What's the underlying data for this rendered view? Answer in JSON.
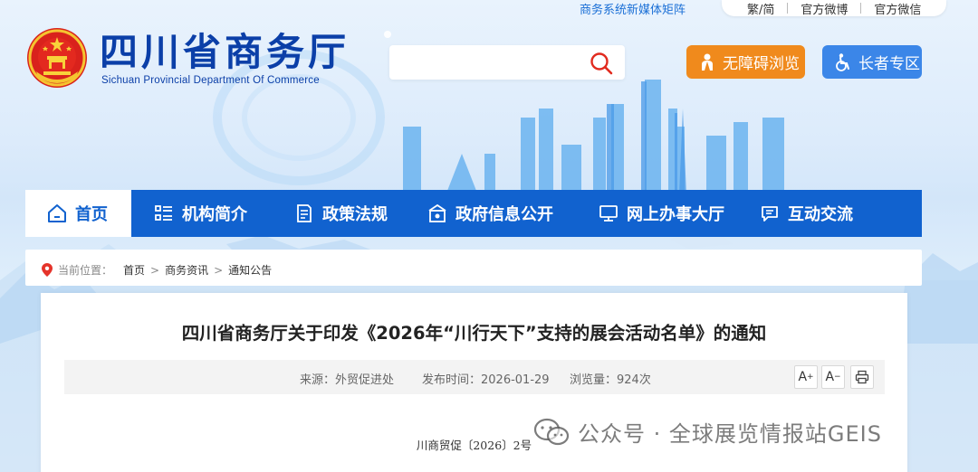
{
  "header": {
    "top_links": {
      "matrix": "商务系统新媒体矩阵",
      "items": [
        "繁/简",
        "官方微博",
        "官方微信"
      ]
    },
    "title": "四川省商务厅",
    "subtitle": "Sichuan Provincial Department Of Commerce",
    "search": {
      "placeholder": "",
      "value": "",
      "icon": "search-icon"
    },
    "accessible_label": "无障碍浏览",
    "elder_label": "长者专区"
  },
  "nav": {
    "items": [
      {
        "label": "首页",
        "icon": "home-icon",
        "active": true
      },
      {
        "label": "机构简介",
        "icon": "list-icon"
      },
      {
        "label": "政策法规",
        "icon": "document-icon"
      },
      {
        "label": "政府信息公开",
        "icon": "building-icon"
      },
      {
        "label": "网上办事大厅",
        "icon": "monitor-icon"
      },
      {
        "label": "互动交流",
        "icon": "chat-icon"
      }
    ]
  },
  "breadcrumb": {
    "label": "当前位置：",
    "items": [
      "首页",
      "商务资讯",
      "通知公告"
    ],
    "separator": ">"
  },
  "article": {
    "title": "四川省商务厅关于印发《2026年“川行天下”支持的展会活动名单》的通知",
    "source": "来源：外贸促进处",
    "date": "发布时间：2026-01-29",
    "views": "浏览量：924次",
    "doc_number": "川商贸促〔2026〕2号"
  },
  "watermark": {
    "text": "公众号 · 全球展览情报站GEIS"
  },
  "colors": {
    "brand_blue": "#1162cf",
    "title_blue": "#0b3fa8",
    "accessible_orange": "#f08a1c",
    "elder_blue": "#3b86e8"
  }
}
